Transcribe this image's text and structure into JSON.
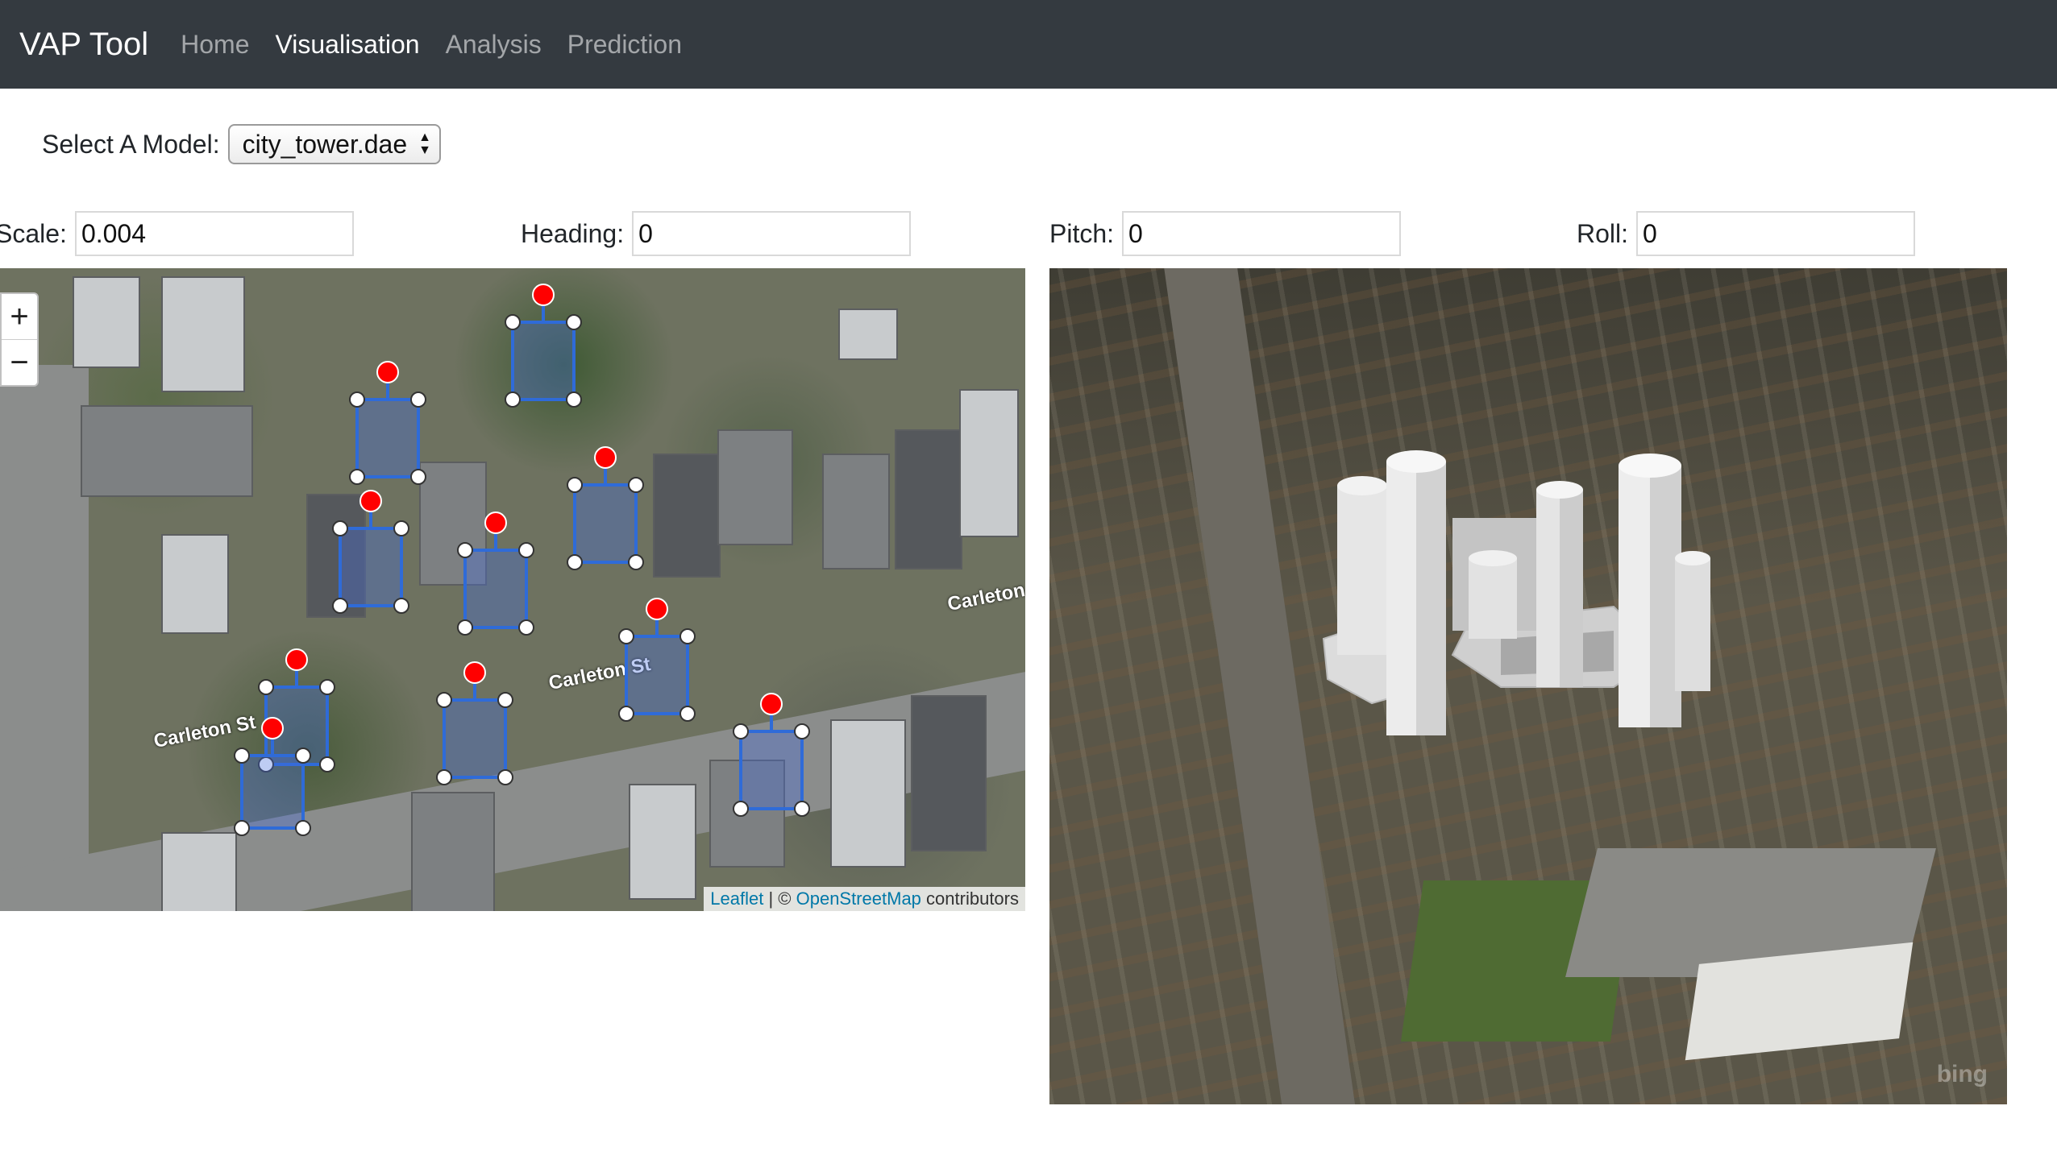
{
  "navbar": {
    "brand": "VAP Tool",
    "links": [
      {
        "label": "Home",
        "active": false
      },
      {
        "label": "Visualisation",
        "active": true
      },
      {
        "label": "Analysis",
        "active": false
      },
      {
        "label": "Prediction",
        "active": false
      }
    ]
  },
  "model_select": {
    "label": "Select A Model:",
    "value": "city_tower.dae"
  },
  "transform": {
    "scale": {
      "label": "Scale:",
      "value": "0.004"
    },
    "heading": {
      "label": "Heading:",
      "value": "0"
    },
    "pitch": {
      "label": "Pitch:",
      "value": "0"
    },
    "roll": {
      "label": "Roll:",
      "value": "0"
    }
  },
  "map": {
    "zoom_in": "+",
    "zoom_out": "−",
    "street_labels": [
      "Carleton St",
      "Carleton St",
      "Carleton"
    ],
    "attribution": {
      "leaflet": "Leaflet",
      "separator": "| ©",
      "osm": "OpenStreetMap",
      "suffix": "contributors"
    }
  },
  "view3d": {
    "watermark": "bing"
  },
  "colors": {
    "navbar_bg": "#343a40",
    "footprint_stroke": "#2f6bd8",
    "handle_red": "#ff0000"
  }
}
